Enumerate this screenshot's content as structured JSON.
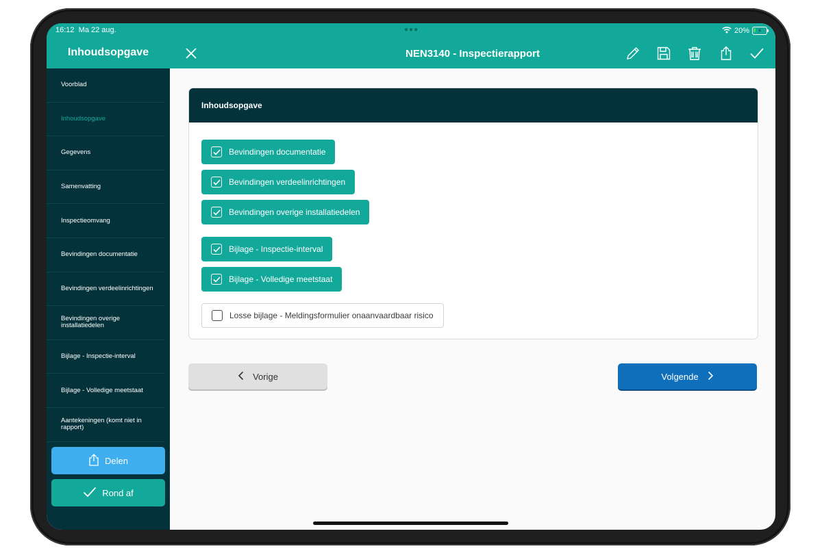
{
  "status_bar": {
    "time": "16:12",
    "date": "Ma 22 aug.",
    "battery": "20%",
    "battery_level": 0.2
  },
  "sidebar": {
    "title": "Inhoudsopgave",
    "items": [
      {
        "label": "Voorblad",
        "active": false
      },
      {
        "label": "Inhoudsopgave",
        "active": true
      },
      {
        "label": "Gegevens",
        "active": false
      },
      {
        "label": "Samenvatting",
        "active": false
      },
      {
        "label": "Inspectieomvang",
        "active": false
      },
      {
        "label": "Bevindingen documentatie",
        "active": false
      },
      {
        "label": "Bevindingen verdeelinrichtingen",
        "active": false
      },
      {
        "label": "Bevindingen overige installatiedelen",
        "active": false
      },
      {
        "label": "Bijlage - Inspectie-interval",
        "active": false
      },
      {
        "label": "Bijlage - Volledige meetstaat",
        "active": false
      },
      {
        "label": "Aantekeningen (komt niet in rapport)",
        "active": false
      }
    ],
    "share_label": "Delen",
    "finish_label": "Rond af"
  },
  "topbar": {
    "title": "NEN3140 - Inspectierapport",
    "icons": [
      "close-icon",
      "pencil-icon",
      "save-icon",
      "trash-icon",
      "share-icon",
      "checkmark-icon"
    ]
  },
  "card": {
    "title": "Inhoudsopgave",
    "options": [
      {
        "label": "Bevindingen documentatie",
        "checked": true
      },
      {
        "label": "Bevindingen verdeelinrichtingen",
        "checked": true
      },
      {
        "label": "Bevindingen overige installatiedelen",
        "checked": true
      },
      {
        "label": "Bijlage - Inspectie-interval",
        "checked": true
      },
      {
        "label": "Bijlage - Volledige meetstaat",
        "checked": true
      },
      {
        "label": "Losse bijlage - Meldingsformulier onaanvaardbaar risico",
        "checked": false
      }
    ]
  },
  "navigation": {
    "prev_label": "Vorige",
    "next_label": "Volgende"
  },
  "colors": {
    "teal": "#13a99a",
    "dark": "#04323b",
    "blue": "#0f6fba",
    "light_blue": "#3eaeee"
  }
}
